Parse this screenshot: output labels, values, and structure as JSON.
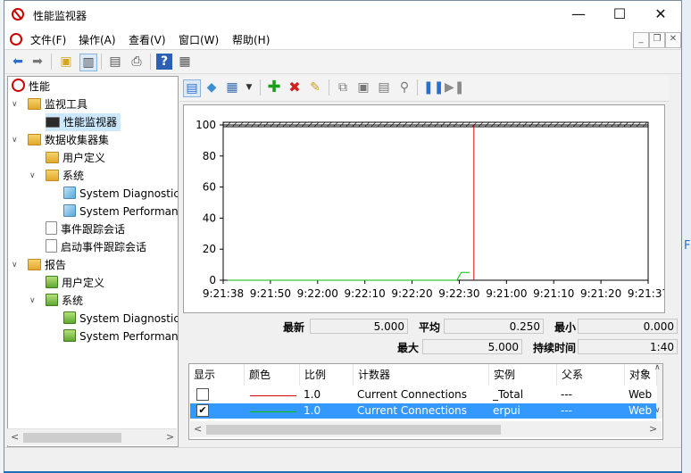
{
  "window": {
    "title": "性能监视器",
    "minimize": "—",
    "maximize": "☐",
    "close": "✕"
  },
  "menu": {
    "items": [
      "文件(F)",
      "操作(A)",
      "查看(V)",
      "窗口(W)",
      "帮助(H)"
    ]
  },
  "tree": {
    "root": "性能",
    "monitoring_tools": "监视工具",
    "performance_monitor": "性能监视器",
    "data_collector_sets": "数据收集器集",
    "user_defined": "用户定义",
    "system": "系统",
    "system_diagnostics": "System Diagnostics",
    "system_performance": "System Performance",
    "event_trace_sessions": "事件跟踪会话",
    "startup_event_trace_sessions": "启动事件跟踪会话",
    "reports": "报告",
    "report_user_defined": "用户定义",
    "report_system": "系统",
    "report_system_diagnostics": "System Diagnostics",
    "report_system_performance": "System Performance"
  },
  "chart_data": {
    "type": "line",
    "y_ticks": [
      "100",
      "80",
      "60",
      "40",
      "20",
      "0"
    ],
    "x_ticks": [
      "9:21:38",
      "9:21:50",
      "9:22:00",
      "9:22:10",
      "9:22:20",
      "9:22:30",
      "9:21:00",
      "9:21:10",
      "9:21:20",
      "9:21:37"
    ],
    "ylim": [
      0,
      100
    ],
    "series": [
      {
        "color": "#00c000",
        "values": [
          0,
          0,
          0,
          0,
          0,
          0,
          0,
          0,
          0,
          0,
          0,
          0,
          0,
          0,
          0,
          0,
          0,
          0,
          0,
          0,
          0,
          0,
          0,
          0,
          0,
          0,
          0,
          0,
          0,
          0,
          0,
          0,
          0,
          0,
          0,
          0,
          0,
          0,
          0,
          0,
          0,
          0,
          0,
          0,
          0,
          0,
          0,
          0,
          0,
          0,
          0,
          0,
          0,
          0,
          0,
          5,
          5,
          5
        ]
      }
    ],
    "current_time_line_color": "#cc0000"
  },
  "stats": {
    "latest_label": "最新",
    "latest_value": "5.000",
    "average_label": "平均",
    "average_value": "0.250",
    "minimum_label": "最小",
    "minimum_value": "0.000",
    "maximum_label": "最大",
    "maximum_value": "5.000",
    "duration_label": "持续时间",
    "duration_value": "1:40"
  },
  "counters": {
    "headers": {
      "show": "显示",
      "color": "颜色",
      "scale": "比例",
      "counter": "计数器",
      "instance": "实例",
      "parent": "父系",
      "object": "对象"
    },
    "rows": [
      {
        "checked": "",
        "scale": "1.0",
        "counter": "Current Connections",
        "instance": "_Total",
        "parent": "---",
        "object": "Web",
        "line_color": "#cc0000"
      },
      {
        "checked": "✔",
        "scale": "1.0",
        "counter": "Current Connections",
        "instance": "erpui",
        "parent": "---",
        "object": "Web",
        "line_color": "#00c000"
      }
    ]
  }
}
